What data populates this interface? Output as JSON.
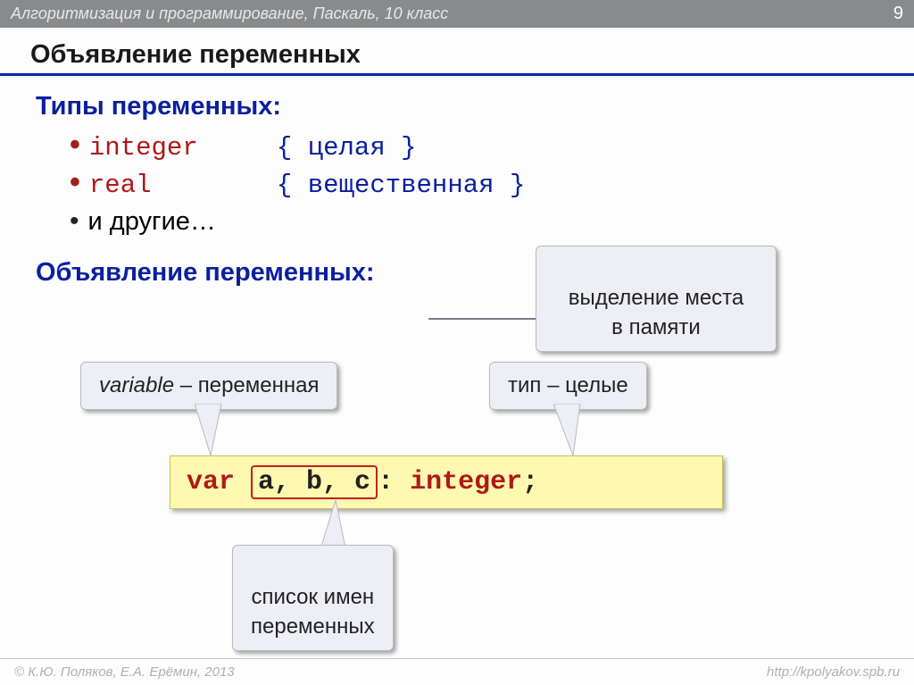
{
  "header": {
    "course": "Алгоритмизация и программирование, Паскаль, 10 класс",
    "page": "9"
  },
  "title": "Объявление переменных",
  "types_heading": "Типы переменных:",
  "types": [
    {
      "keyword": "integer",
      "comment": "{ целая }"
    },
    {
      "keyword": "real",
      "comment": "{ вещественная }"
    }
  ],
  "others": "и другие…",
  "decl_heading": "Объявление переменных:",
  "callouts": {
    "memory": "выделение места\nв памяти",
    "variable_pre": "variable",
    "variable_post": " – переменная",
    "type": "тип – целые",
    "names": "список имен\nпеременных"
  },
  "code": {
    "var_kw": "var",
    "vars": "a, b, c",
    "colon": ":",
    "type": "integer",
    "semi": ";"
  },
  "footer": {
    "copyright": "© К.Ю. Поляков, Е.А. Ерёмин, 2013",
    "url": "http://kpolyakov.spb.ru"
  }
}
